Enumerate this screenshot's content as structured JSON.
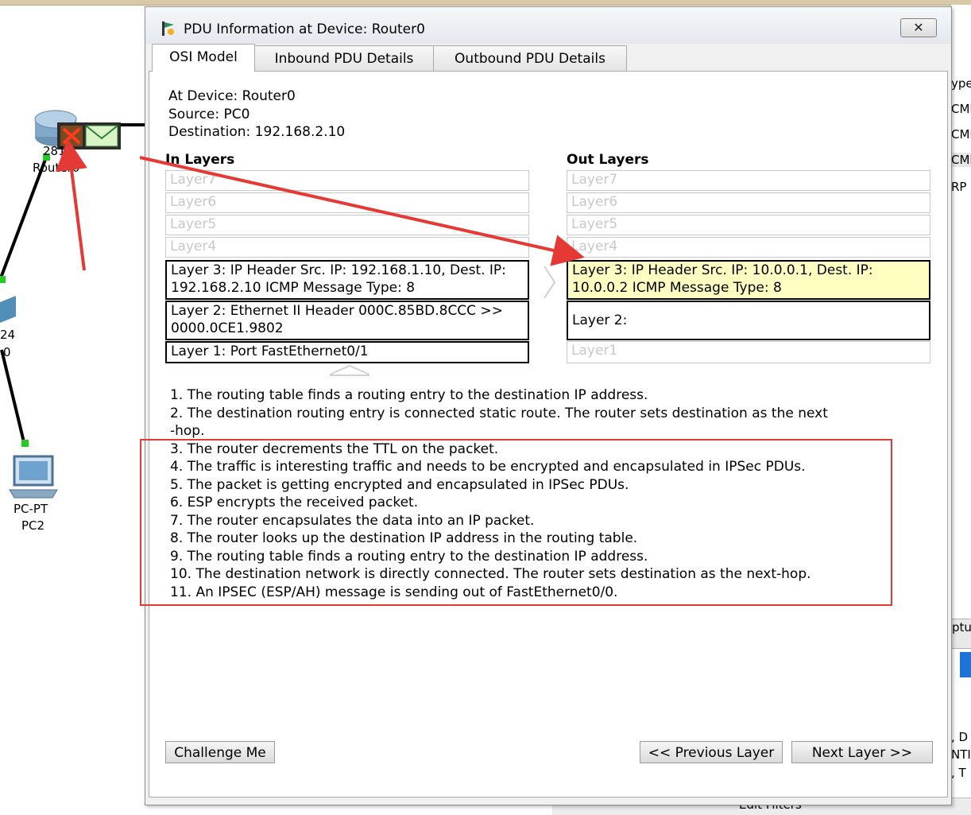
{
  "workspace": {
    "router_model": "2811",
    "router_name": "Router0",
    "pc_type": "PC-PT",
    "pc_name": "PC2",
    "switch_frag_1": "24",
    "switch_frag_2": "0",
    "right_frags": [
      "ype",
      "CMI",
      "CMI",
      "CMI",
      "RP",
      "ptu",
      ", D",
      "NTI",
      ", T"
    ],
    "edit_filters": "Edit Filters",
    "colors": {
      "link": "#000000",
      "port_up": "#22cc22",
      "annotation": "#e53935"
    }
  },
  "dialog": {
    "title": "PDU Information at Device: Router0",
    "close_glyph": "✕",
    "tabs": [
      {
        "label": "OSI Model",
        "active": true
      },
      {
        "label": "Inbound PDU Details",
        "active": false
      },
      {
        "label": "Outbound PDU Details",
        "active": false
      }
    ],
    "info": {
      "at_device": "At Device: Router0",
      "source": "Source: PC0",
      "destination": "Destination: 192.168.2.10"
    },
    "in_layers": {
      "heading": "In Layers",
      "items": [
        "Layer7",
        "Layer6",
        "Layer5",
        "Layer4",
        "Layer 3: IP Header Src. IP: 192.168.1.10, Dest. IP: 192.168.2.10 ICMP Message Type: 8",
        "Layer 2: Ethernet II Header 000C.85BD.8CCC >> 0000.0CE1.9802",
        "Layer 1: Port FastEthernet0/1"
      ]
    },
    "out_layers": {
      "heading": "Out Layers",
      "items": [
        "Layer7",
        "Layer6",
        "Layer5",
        "Layer4",
        "Layer 3: IP Header Src. IP: 10.0.0.1, Dest. IP: 10.0.0.2 ICMP Message Type: 8",
        "Layer 2:",
        "Layer1"
      ]
    },
    "steps": [
      "1. The routing table finds a routing entry to the destination IP address.",
      "2. The destination routing entry is connected static route. The router sets destination as the next",
      "-hop.",
      "3. The router decrements the TTL on the packet.",
      "4. The traffic is interesting traffic and needs to be encrypted and encapsulated in IPSec PDUs.",
      "5. The packet is getting encrypted and encapsulated in IPSec PDUs.",
      "6. ESP encrypts the received packet.",
      "7. The router encapsulates the data into an IP packet.",
      "8. The router looks up the destination IP address in the routing table.",
      "9. The routing table finds a routing entry to the destination IP address.",
      "10. The destination network is directly connected. The router sets destination as the next-hop.",
      "11. An IPSEC (ESP/AH) message is sending out of FastEthernet0/0."
    ],
    "buttons": {
      "challenge": "Challenge Me",
      "previous": "<< Previous Layer",
      "next": "Next Layer >>"
    }
  }
}
